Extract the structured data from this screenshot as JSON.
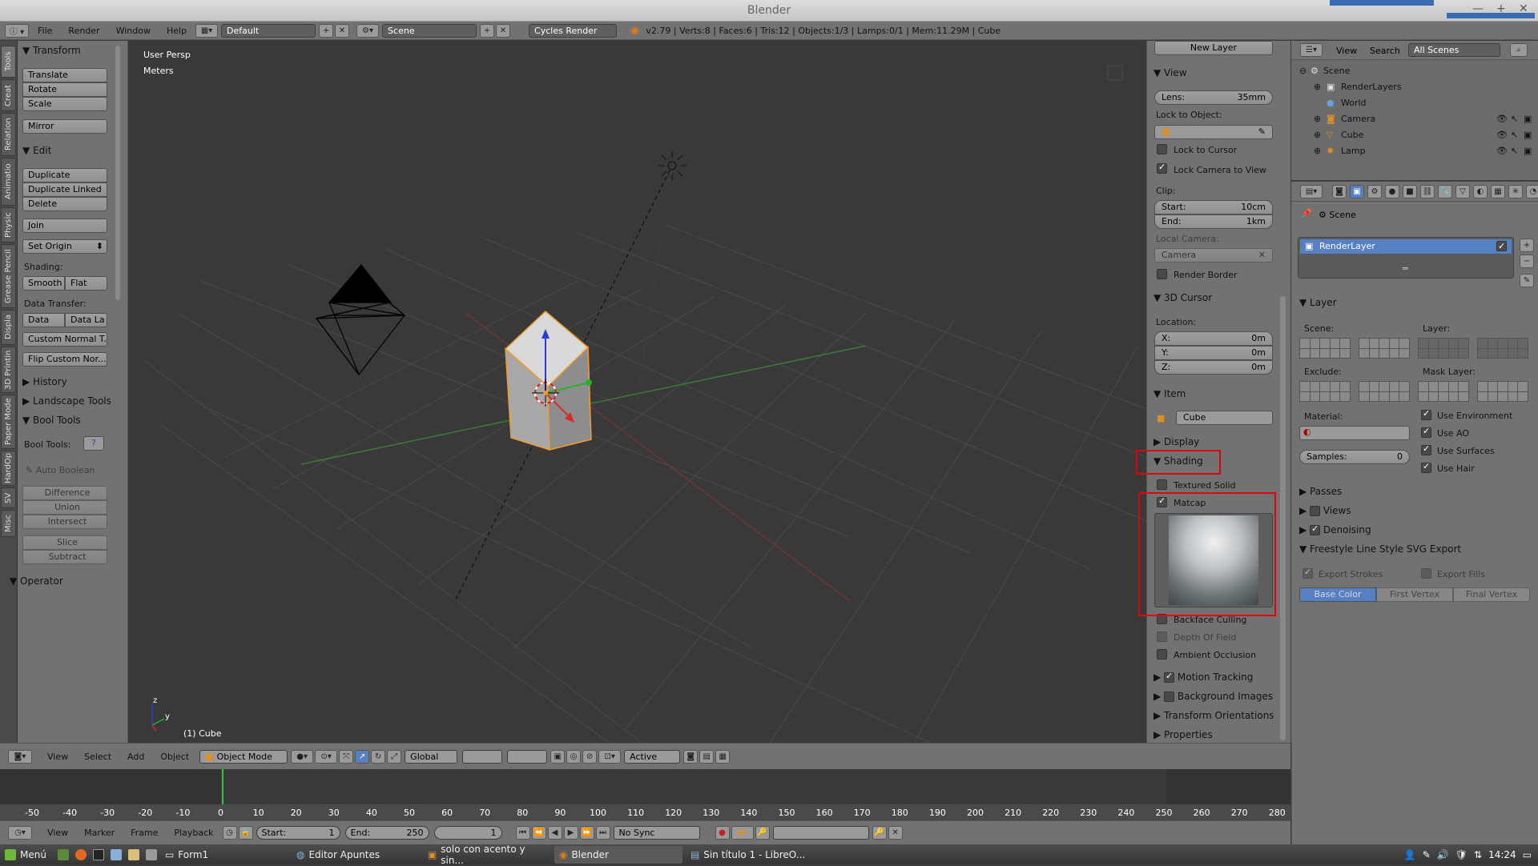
{
  "window": {
    "title": "Blender"
  },
  "infobar": {
    "menus": [
      "File",
      "Render",
      "Window",
      "Help"
    ],
    "layout": "Default",
    "scene": "Scene",
    "engine": "Cycles Render",
    "stats": "v2.79 | Verts:8 | Faces:6 | Tris:12 | Objects:1/3 | Lamps:0/1 | Mem:11.29M | Cube"
  },
  "tabs": [
    "Tools",
    "Creat",
    "Relation",
    "Animatio",
    "Physic",
    "Grease Pencil",
    "Displa",
    "3D Printin",
    "Paper Mode",
    "HardOp",
    "SV",
    "Misc"
  ],
  "toolshelf": {
    "transform_title": "Transform",
    "transform": [
      "Translate",
      "Rotate",
      "Scale"
    ],
    "mirror": "Mirror",
    "edit_title": "Edit",
    "edit": [
      "Duplicate",
      "Duplicate Linked",
      "Delete"
    ],
    "join": "Join",
    "set_origin": "Set Origin",
    "shading_label": "Shading:",
    "smooth": "Smooth",
    "flat": "Flat",
    "data_transfer_label": "Data Transfer:",
    "data": "Data",
    "data_la": "Data La",
    "custom_normal": "Custom Normal T...",
    "flip_custom": "Flip Custom Nor...",
    "history": "History",
    "landscape": "Landscape Tools",
    "bool_title": "Bool Tools",
    "bool_label": "Bool Tools:",
    "auto_boolean": "Auto Boolean",
    "bool_ops": [
      "Difference",
      "Union",
      "Intersect"
    ],
    "slice": "Slice",
    "subtract": "Subtract",
    "operator": "Operator"
  },
  "viewport": {
    "persp": "User Persp",
    "units": "Meters",
    "object": "(1) Cube"
  },
  "npanel": {
    "new_layer": "New Layer",
    "view_title": "View",
    "lens_label": "Lens:",
    "lens_value": "35mm",
    "lock_to_object": "Lock to Object:",
    "lock_to_cursor": "Lock to Cursor",
    "lock_camera": "Lock Camera to View",
    "clip": "Clip:",
    "start_label": "Start:",
    "start_value": "10cm",
    "end_label": "End:",
    "end_value": "1km",
    "local_camera": "Local Camera:",
    "camera": "Camera",
    "render_border": "Render Border",
    "cursor_title": "3D Cursor",
    "location": "Location:",
    "x_label": "X:",
    "x_value": "0m",
    "y_label": "Y:",
    "y_value": "0m",
    "z_label": "Z:",
    "z_value": "0m",
    "item_title": "Item",
    "item_name": "Cube",
    "display_title": "Display",
    "shading_title": "Shading",
    "textured_solid": "Textured Solid",
    "matcap": "Matcap",
    "backface": "Backface Culling",
    "dof": "Depth Of Field",
    "ao": "Ambient Occlusion",
    "motion_tracking": "Motion Tracking",
    "background_images": "Background Images",
    "transform_orient": "Transform Orientations",
    "properties": "Properties"
  },
  "outliner": {
    "view": "View",
    "search": "Search",
    "filter": "All Scenes",
    "rows": [
      "Scene",
      "RenderLayers",
      "World",
      "Camera",
      "Cube",
      "Lamp"
    ]
  },
  "properties": {
    "scene": "Scene",
    "render_layer": "RenderLayer",
    "layer_title": "Layer",
    "scene_label": "Scene:",
    "layer_label": "Layer:",
    "exclude": "Exclude:",
    "mask_layer": "Mask Layer:",
    "material": "Material:",
    "use_environment": "Use Environment",
    "use_ao": "Use AO",
    "use_surfaces": "Use Surfaces",
    "use_hair": "Use Hair",
    "samples_label": "Samples:",
    "samples_value": "0",
    "passes": "Passes",
    "views": "Views",
    "denoising": "Denoising",
    "freestyle": "Freestyle Line Style SVG Export",
    "export_strokes": "Export Strokes",
    "export_fills": "Export Fills",
    "seg": [
      "Base Color",
      "First Vertex",
      "Final Vertex"
    ]
  },
  "vphdr": {
    "menus": [
      "View",
      "Select",
      "Add",
      "Object"
    ],
    "mode": "Object Mode",
    "orientation": "Global",
    "pivot": "Active"
  },
  "timeline": {
    "ticks": [
      "-50",
      "-40",
      "-30",
      "-20",
      "-10",
      "0",
      "10",
      "20",
      "30",
      "40",
      "50",
      "60",
      "70",
      "80",
      "90",
      "100",
      "110",
      "120",
      "130",
      "140",
      "150",
      "160",
      "170",
      "180",
      "190",
      "200",
      "210",
      "220",
      "230",
      "240",
      "250",
      "260",
      "270",
      "280"
    ],
    "menus": [
      "View",
      "Marker",
      "Frame",
      "Playback"
    ],
    "start_label": "Start:",
    "start_value": "1",
    "end_label": "End:",
    "end_value": "250",
    "current": "1",
    "sync": "No Sync"
  },
  "taskbar": {
    "menu": "Menú",
    "tasks": [
      "Form1",
      "Editor Apuntes",
      "solo con acento y sin...",
      "Blender",
      "Sin título 1 - LibreO..."
    ],
    "time": "14:24"
  },
  "colors": {
    "accent": "#5680c2",
    "highlight": "#e00010",
    "selection": "#f39a2a"
  }
}
